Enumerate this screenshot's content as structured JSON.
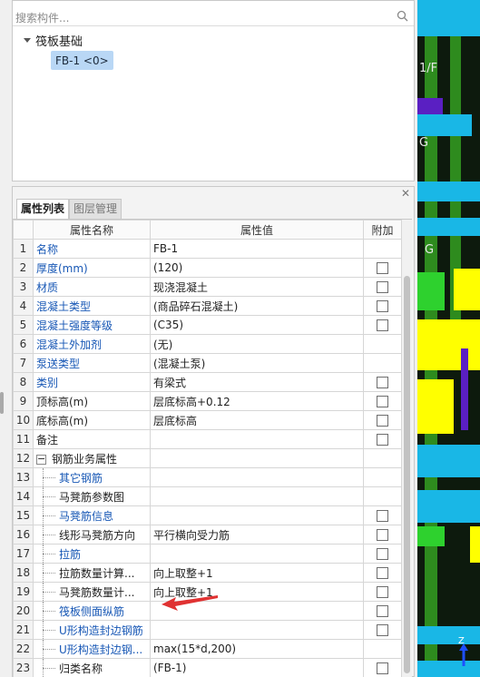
{
  "search": {
    "placeholder": "搜索构件..."
  },
  "tree": {
    "root_label": "筏板基础",
    "child_label": "FB-1 <0>"
  },
  "panel": {
    "close_glyph": "✕",
    "tabs": [
      "属性列表",
      "图层管理"
    ],
    "columns": [
      "属性名称",
      "属性值",
      "附加"
    ]
  },
  "rows": [
    {
      "no": "1",
      "name": "名称",
      "value": "FB-1"
    },
    {
      "no": "2",
      "name": "厚度(mm)",
      "value": "(120)"
    },
    {
      "no": "3",
      "name": "材质",
      "value": "现浇混凝土"
    },
    {
      "no": "4",
      "name": "混凝土类型",
      "value": "(商品碎石混凝土)"
    },
    {
      "no": "5",
      "name": "混凝土强度等级",
      "value": "(C35)"
    },
    {
      "no": "6",
      "name": "混凝土外加剂",
      "value": "(无)"
    },
    {
      "no": "7",
      "name": "泵送类型",
      "value": "(混凝土泵)"
    },
    {
      "no": "8",
      "name": "类别",
      "value": "有梁式"
    },
    {
      "no": "9",
      "name": "顶标高(m)",
      "value": "层底标高+0.12"
    },
    {
      "no": "10",
      "name": "底标高(m)",
      "value": "层底标高"
    },
    {
      "no": "11",
      "name": "备注",
      "value": ""
    },
    {
      "no": "12",
      "name": "钢筋业务属性",
      "value": ""
    },
    {
      "no": "13",
      "name": "其它钢筋",
      "value": ""
    },
    {
      "no": "14",
      "name": "马凳筋参数图",
      "value": ""
    },
    {
      "no": "15",
      "name": "马凳筋信息",
      "value": ""
    },
    {
      "no": "16",
      "name": "线形马凳筋方向",
      "value": "平行横向受力筋"
    },
    {
      "no": "17",
      "name": "拉筋",
      "value": ""
    },
    {
      "no": "18",
      "name": "拉筋数量计算...",
      "value": "向上取整+1"
    },
    {
      "no": "19",
      "name": "马凳筋数量计...",
      "value": "向上取整+1"
    },
    {
      "no": "20",
      "name": "筏板侧面纵筋",
      "value": ""
    },
    {
      "no": "21",
      "name": "U形构造封边钢筋",
      "value": ""
    },
    {
      "no": "22",
      "name": "U形构造封边钢...",
      "value": "max(15*d,200)"
    },
    {
      "no": "23",
      "name": "归类名称",
      "value": "(FB-1)"
    }
  ],
  "viewport": {
    "labels": [
      "1/F",
      "G",
      "G"
    ],
    "axis_label": "Z"
  },
  "colors": {
    "link_blue": "#1757b5",
    "selection": "#b9d7f5",
    "annotation_arrow": "#e03232",
    "viewport_green": "#2e8b1e",
    "viewport_yellow": "#ffff00",
    "viewport_cyan": "#19b7e6",
    "viewport_purple": "#5a1fc2"
  }
}
